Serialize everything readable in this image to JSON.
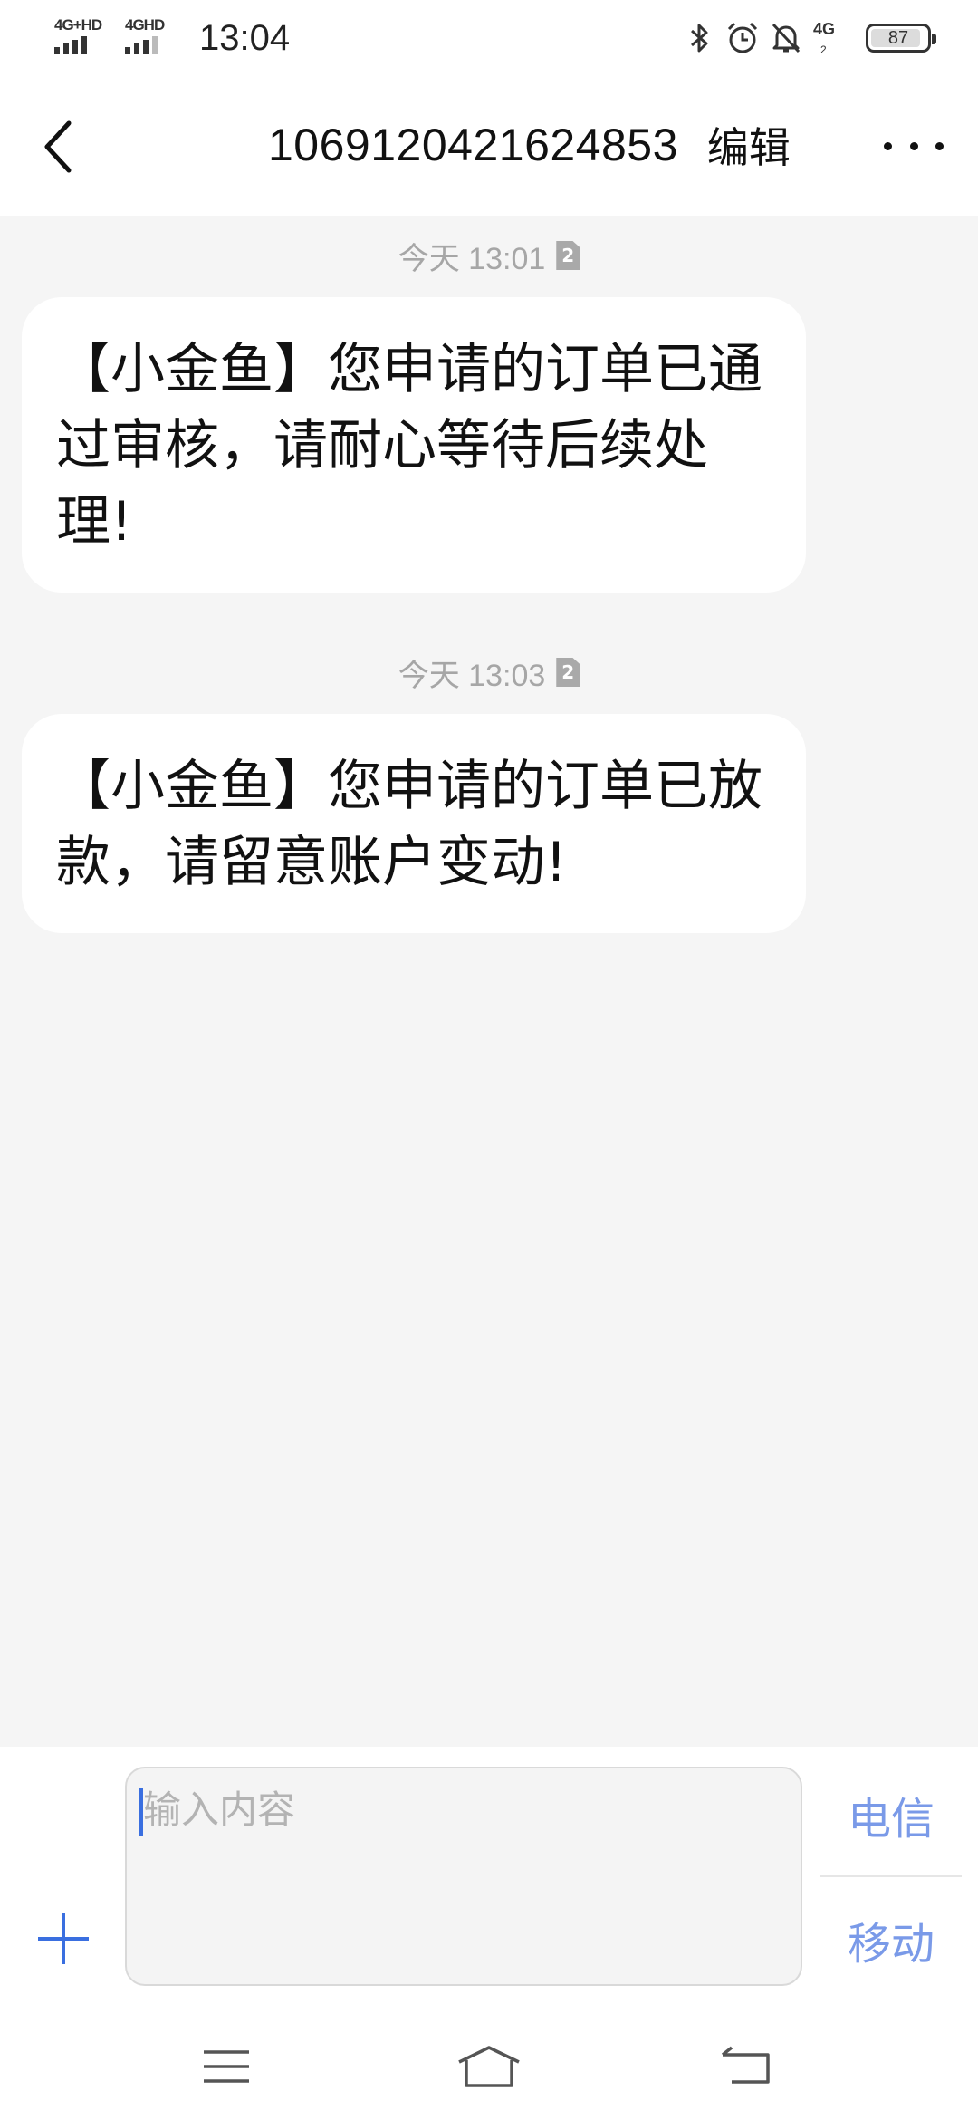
{
  "status_bar": {
    "network_1": "4G+HD",
    "network_2": "4GHD",
    "time": "13:04",
    "network_small": "4G",
    "network_small_sub": "2",
    "battery": "87",
    "icons": [
      "bluetooth-icon",
      "alarm-icon",
      "mute-icon"
    ]
  },
  "header": {
    "title": "1069120421624853",
    "edit_label": "编辑",
    "back_icon": "chevron-left-icon",
    "more_icon": "more-dots-icon"
  },
  "messages": [
    {
      "timestamp": "今天 13:01",
      "sim": "2",
      "text": "【小金鱼】您申请的订单已通过审核，请耐心等待后续处理!"
    },
    {
      "timestamp": "今天 13:03",
      "sim": "2",
      "text": "【小金鱼】您申请的订单已放款，请留意账户变动!"
    }
  ],
  "composer": {
    "placeholder": "输入内容",
    "sim_options": [
      "电信",
      "移动"
    ],
    "add_icon": "plus-icon",
    "accent_color": "#3a6fe0"
  },
  "nav_bar": {
    "icons": [
      "menu-icon",
      "home-icon",
      "back-nav-icon"
    ]
  }
}
